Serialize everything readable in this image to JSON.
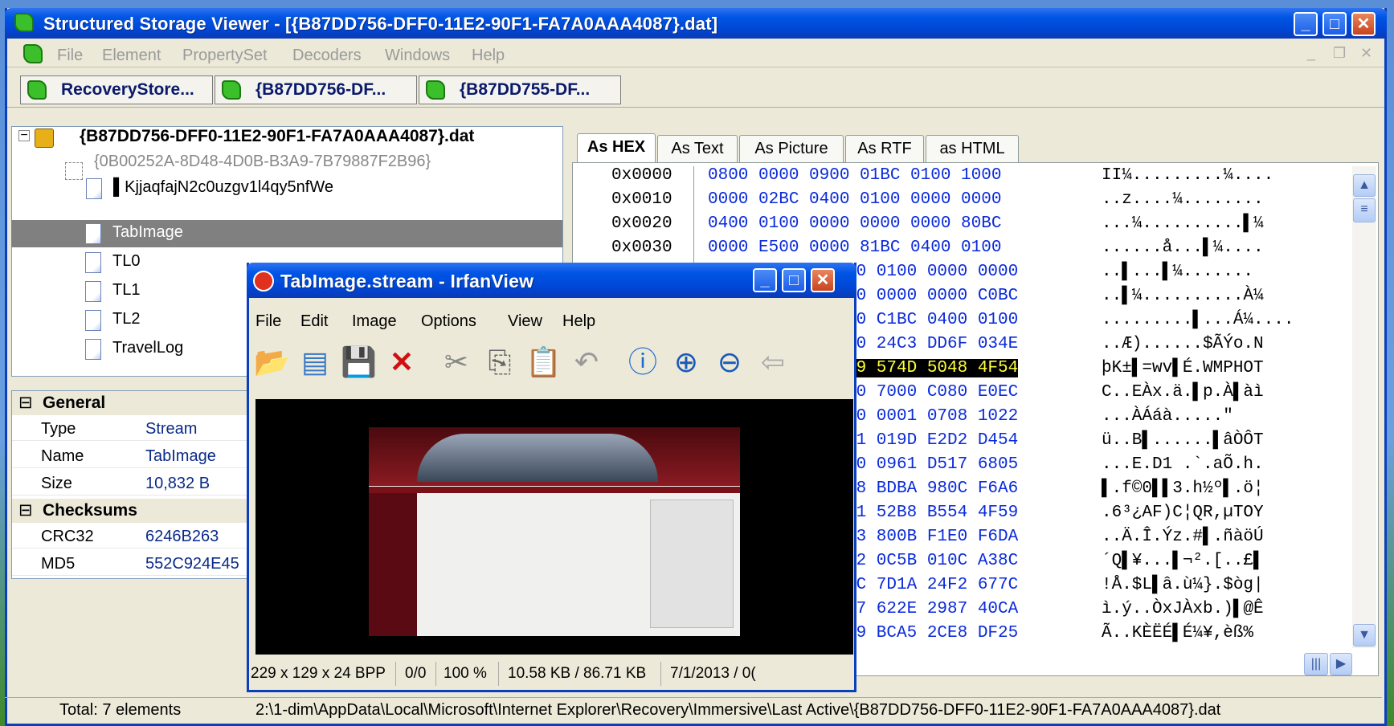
{
  "main_window": {
    "title": "Structured Storage Viewer - [{B87DD756-DFF0-11E2-90F1-FA7A0AAA4087}.dat]",
    "menu": [
      "File",
      "Element",
      "PropertySet",
      "Decoders",
      "Windows",
      "Help"
    ],
    "doc_tabs": [
      "RecoveryStore...",
      "{B87DD756-DF...",
      "{B87DD755-DF..."
    ]
  },
  "tree": {
    "root": "{B87DD756-DFF0-11E2-90F1-FA7A0AAA4087}.dat",
    "children": [
      "{0B00252A-8D48-4D0B-B3A9-7B79887F2B96}",
      "▌KjjaqfajN2c0uzgv1l4qy5nfWe",
      "TabImage",
      "TL0",
      "TL1",
      "TL2",
      "TravelLog"
    ],
    "selected": "TabImage"
  },
  "properties": {
    "general_label": "General",
    "checksums_label": "Checksums",
    "rows": [
      {
        "key": "Type",
        "value": "Stream"
      },
      {
        "key": "Name",
        "value": "TabImage"
      },
      {
        "key": "Size",
        "value": "10,832 B"
      }
    ],
    "checksum_rows": [
      {
        "key": "CRC32",
        "value": "6246B263"
      },
      {
        "key": "MD5",
        "value": "552C924E45"
      }
    ]
  },
  "view_tabs": [
    "As HEX",
    "As Text",
    "As Picture",
    "As RTF",
    "as HTML"
  ],
  "hex": {
    "rows": [
      {
        "off": "0x0000",
        "bytes": "0800 0000 0900 01BC 0100 1000",
        "ascii": "II¼.........¼...."
      },
      {
        "off": "0x0010",
        "bytes": "0000 02BC 0400 0100 0000 0000",
        "ascii": "..z....¼........"
      },
      {
        "off": "0x0020",
        "bytes": "0400 0100 0000 0000 0000 80BC",
        "ascii": "...¼..........▌¼"
      },
      {
        "off": "0x0030",
        "bytes": "0000 E500 0000 81BC 0400 0100",
        "ascii": "......å...▌¼...."
      },
      {
        "off": "",
        "bytes": "00 0100 0000 0000",
        "ascii": "..▌...▌¼......."
      },
      {
        "off": "",
        "bytes": "00 0000 0000 C0BC",
        "ascii": "..▌¼..........À¼"
      },
      {
        "off": "",
        "bytes": "00 C1BC 0400 0100",
        "ascii": ".........▌...Á¼...."
      },
      {
        "off": "",
        "bytes": "00 24C3 DD6F 034E",
        "ascii": "..Æ)......$ÃÝo.N"
      },
      {
        "off": "",
        "bytes": "09 574D 5048 4F54",
        "ascii": "þK±▌=wv▌É.WMPHOT"
      },
      {
        "off": "",
        "bytes": "80 7000 C080 E0EC",
        "ascii": "C..EÀx.ä.▌p.À▌àì"
      },
      {
        "off": "",
        "bytes": "00 0001 0708 1022",
        "ascii": "...ÀÁáà.....\""
      },
      {
        "off": "",
        "bytes": "01 019D E2D2 D454",
        "ascii": "ü..B▌......▌âÒÔT"
      },
      {
        "off": "",
        "bytes": "60 0961 D517 6805",
        "ascii": "...E.D1 .`.aÕ.h."
      },
      {
        "off": "",
        "bytes": "68 BDBA 980C F6A6",
        "ascii": "▌.f©0▌▌3.h½º▌.ö¦"
      },
      {
        "off": "",
        "bytes": "51 52B8 B554 4F59",
        "ascii": ".6³¿AF)C¦QR,µTOY"
      },
      {
        "off": "",
        "bytes": "23 800B F1E0 F6DA",
        "ascii": "..Ä.Î.Ýz.#▌.ñàöÚ"
      },
      {
        "off": "",
        "bytes": "B2 0C5B 010C A38C",
        "ascii": "´Q▌¥...▌¬².[..£▌"
      },
      {
        "off": "",
        "bytes": "BC 7D1A 24F2 677C",
        "ascii": "!Å.$L▌â.ù¼}.$òg|"
      },
      {
        "off": "",
        "bytes": "D7 622E 2987 40CA",
        "ascii": "ì.ý..ÒxJÀxb.)▌@Ê"
      },
      {
        "off": "",
        "bytes": "C9 BCA5 2CE8 DF25",
        "ascii": "Ã..KÈËÉ▌É¼¥,èß%"
      }
    ]
  },
  "status": {
    "total": "Total: 7 elements",
    "path": "2:\\1-dim\\AppData\\Local\\Microsoft\\Internet Explorer\\Recovery\\Immersive\\Last Active\\{B87DD756-DFF0-11E2-90F1-FA7A0AAA4087}.dat"
  },
  "irfanview": {
    "title": "TabImage.stream - IrfanView",
    "menu": [
      "File",
      "Edit",
      "Image",
      "Options",
      "View",
      "Help"
    ],
    "status": [
      "229 x 129 x 24 BPP",
      "0/0",
      "100 %",
      "10.58 KB / 86.71 KB",
      "7/1/2013 / 0("
    ]
  },
  "colors": {
    "titlebar": "#0055e5",
    "hex_bytes": "#0a2adb",
    "selected_row": "#808080"
  }
}
